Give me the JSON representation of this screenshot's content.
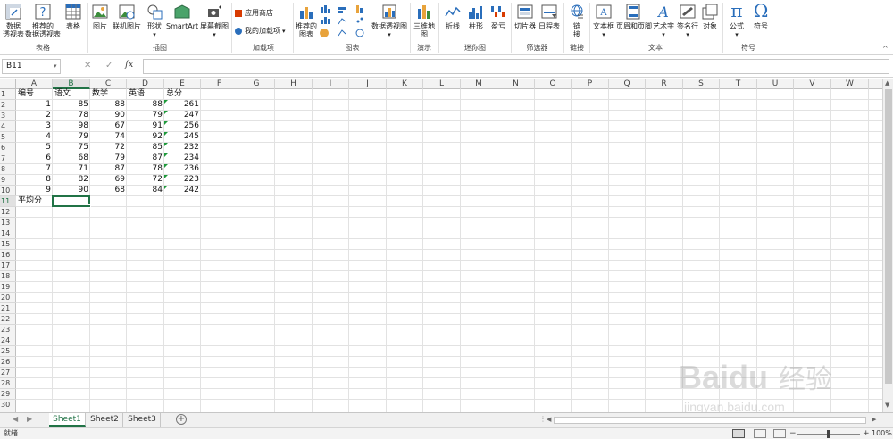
{
  "ribbon": {
    "groups": [
      {
        "label": "表格"
      },
      {
        "label": "插图"
      },
      {
        "label": "加载项"
      },
      {
        "label": "图表"
      },
      {
        "label": "演示"
      },
      {
        "label": "迷你图"
      },
      {
        "label": "筛选器"
      },
      {
        "label": "链接"
      },
      {
        "label": "文本"
      },
      {
        "label": "符号"
      }
    ],
    "buttons": {
      "pivot_table_l1": "数据",
      "pivot_table_l2": "透视表",
      "rec_pivot_l1": "推荐的",
      "rec_pivot_l2": "数据透视表",
      "table": "表格",
      "picture": "图片",
      "online_picture": "联机图片",
      "shapes": "形状",
      "smartart": "SmartArt",
      "screenshot": "屏幕截图",
      "app_store": "应用商店",
      "my_addins": "我的加载项",
      "rec_charts_l1": "推荐的",
      "rec_charts_l2": "图表",
      "pivot_chart": "数据透视图",
      "map3d_l1": "三维地",
      "map3d_l2": "图",
      "line": "折线",
      "column": "柱形",
      "winloss": "盈亏",
      "slicer": "切片器",
      "timeline": "日程表",
      "link_l1": "链",
      "link_l2": "接",
      "textbox": "文本框",
      "header_footer": "页眉和页脚",
      "wordart": "艺术字",
      "signature": "签名行",
      "object": "对象",
      "equation": "公式",
      "symbol": "符号"
    },
    "accent": "#217346"
  },
  "formula_bar": {
    "name_box": "B11",
    "fx_label": "fx",
    "cancel_icon": "✕",
    "enter_icon": "✓",
    "content": ""
  },
  "columns": [
    "A",
    "B",
    "C",
    "D",
    "E",
    "F",
    "G",
    "H",
    "I",
    "J",
    "K",
    "L",
    "M",
    "N",
    "O",
    "P",
    "Q",
    "R",
    "S",
    "T",
    "U",
    "V",
    "W"
  ],
  "rows": [
    "1",
    "2",
    "3",
    "4",
    "5",
    "6",
    "7",
    "8",
    "9",
    "10",
    "11",
    "12",
    "13",
    "14",
    "15",
    "16",
    "17",
    "18",
    "19",
    "20",
    "21",
    "22",
    "23",
    "24",
    "25",
    "26",
    "27",
    "28",
    "29",
    "30",
    "31"
  ],
  "sheet": {
    "headers": [
      "编号",
      "语文",
      "数学",
      "英语",
      "总分"
    ],
    "data": [
      [
        "1",
        "85",
        "88",
        "88",
        "261"
      ],
      [
        "2",
        "78",
        "90",
        "79",
        "247"
      ],
      [
        "3",
        "98",
        "67",
        "91",
        "256"
      ],
      [
        "4",
        "79",
        "74",
        "92",
        "245"
      ],
      [
        "5",
        "75",
        "72",
        "85",
        "232"
      ],
      [
        "6",
        "68",
        "79",
        "87",
        "234"
      ],
      [
        "7",
        "71",
        "87",
        "78",
        "236"
      ],
      [
        "8",
        "82",
        "69",
        "72",
        "223"
      ],
      [
        "9",
        "90",
        "68",
        "84",
        "242"
      ]
    ],
    "avg_label": "平均分"
  },
  "tabs": [
    {
      "label": "Sheet1",
      "active": true
    },
    {
      "label": "Sheet2",
      "active": false
    },
    {
      "label": "Sheet3",
      "active": false
    }
  ],
  "status": {
    "ready": "就绪",
    "zoom": "100%"
  },
  "watermark": {
    "brand": "Bai du 经验",
    "url": "jingyan.baidu.com"
  }
}
